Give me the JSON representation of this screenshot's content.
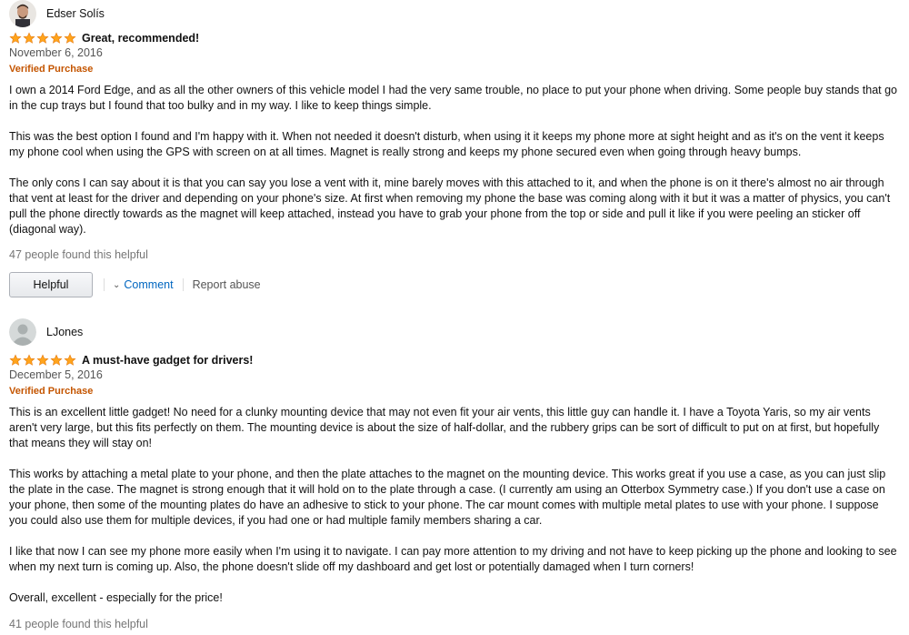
{
  "colors": {
    "star": "#ffa41c",
    "verified": "#c45500",
    "link": "#0066c0",
    "muted": "#767676"
  },
  "reviews": [
    {
      "profile_name": "Edser Solís",
      "avatar": "profile-photo",
      "rating": 5,
      "title": "Great, recommended!",
      "date": "November 6, 2016",
      "verified": "Verified Purchase",
      "paragraphs": [
        "I own a 2014 Ford Edge, and as all the other owners of this vehicle model I had the very same trouble, no place to put your phone when driving. Some people buy stands that go in the cup trays but I found that too bulky and in my way. I like to keep things simple.",
        "This was the best option I found and I'm happy with it. When not needed it doesn't disturb, when using it it keeps my phone more at sight height and as it's on the vent it keeps my phone cool when using the GPS with screen on at all times. Magnet is really strong and keeps my phone secured even when going through heavy bumps.",
        "The only cons I can say about it is that you can say you lose a vent with it, mine barely moves with this attached to it, and when the phone is on it there's almost no air through that vent at least for the driver and depending on your phone's size. At first when removing my phone the base was coming along with it but it was a matter of physics, you can't pull the phone directly towards as the magnet will keep attached, instead you have to grab your phone from the top or side and pull it like if you were peeling an sticker off (diagonal way)."
      ],
      "helpful_count": "47 people found this helpful",
      "helpful_button": "Helpful",
      "comment_label": "Comment",
      "report_label": "Report abuse"
    },
    {
      "profile_name": "LJones",
      "avatar": "default-avatar-icon",
      "rating": 5,
      "title": "A must-have gadget for drivers!",
      "date": "December 5, 2016",
      "verified": "Verified Purchase",
      "paragraphs": [
        "This is an excellent little gadget! No need for a clunky mounting device that may not even fit your air vents, this little guy can handle it. I have a Toyota Yaris, so my air vents aren't very large, but this fits perfectly on them. The mounting device is about the size of half-dollar, and the rubbery grips can be sort of difficult to put on at first, but hopefully that means they will stay on!",
        "This works by attaching a metal plate to your phone, and then the plate attaches to the magnet on the mounting device. This works great if you use a case, as you can just slip the plate in the case. The magnet is strong enough that it will hold on to the plate through a case. (I currently am using an Otterbox Symmetry case.) If you don't use a case on your phone, then some of the mounting plates do have an adhesive to stick to your phone. The car mount comes with multiple metal plates to use with your phone. I suppose you could also use them for multiple devices, if you had one or had multiple family members sharing a car.",
        "I like that now I can see my phone more easily when I'm using it to navigate. I can pay more attention to my driving and not have to keep picking up the phone and looking to see when my next turn is coming up. Also, the phone doesn't slide off my dashboard and get lost or potentially damaged when I turn corners!",
        "Overall, excellent - especially for the price!"
      ],
      "helpful_count": "41 people found this helpful"
    }
  ]
}
